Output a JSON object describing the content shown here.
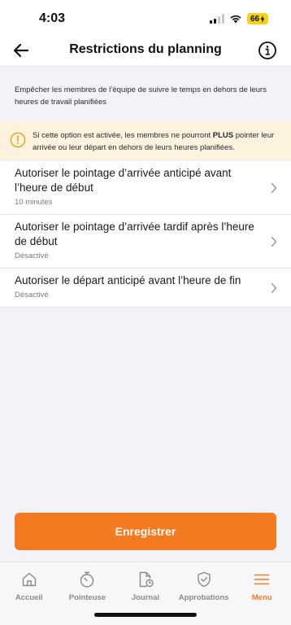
{
  "status_bar": {
    "time": "4:03",
    "battery": "66"
  },
  "header": {
    "title": "Restrictions du planning",
    "back_icon": "arrow-left-icon",
    "info_icon": "info-icon"
  },
  "description": "Empêcher les membres de l’équipe de suivre le temps en dehors de leurs heures de travail planifiées",
  "warning": {
    "icon": "exclamation-circle-icon",
    "text_before": "Si cette option est activée, les membres ne pourront ",
    "text_bold": "PLUS",
    "text_after": " pointer leur arrivée ou leur départ en dehors de leurs heures planifiées.",
    "color": "#fdf2de"
  },
  "settings": [
    {
      "title": "Autoriser le pointage d’arrivée anticipé avant l’heure de début",
      "value": "10 minutes"
    },
    {
      "title": "Autoriser le pointage d’arrivée tardif après l’heure de début",
      "value": "Désactivé"
    },
    {
      "title": "Autoriser le départ anticipé avant l’heure de fin",
      "value": "Désactivé"
    }
  ],
  "save_button": {
    "label": "Enregistrer",
    "color": "#f47a20"
  },
  "tabs": [
    {
      "label": "Accueil",
      "icon": "home-icon",
      "active": false
    },
    {
      "label": "Pointeuse",
      "icon": "stopwatch-icon",
      "active": false
    },
    {
      "label": "Journal",
      "icon": "document-clock-icon",
      "active": false
    },
    {
      "label": "Approbations",
      "icon": "shield-check-icon",
      "active": false
    },
    {
      "label": "Menu",
      "icon": "hamburger-menu-icon",
      "active": true
    }
  ]
}
